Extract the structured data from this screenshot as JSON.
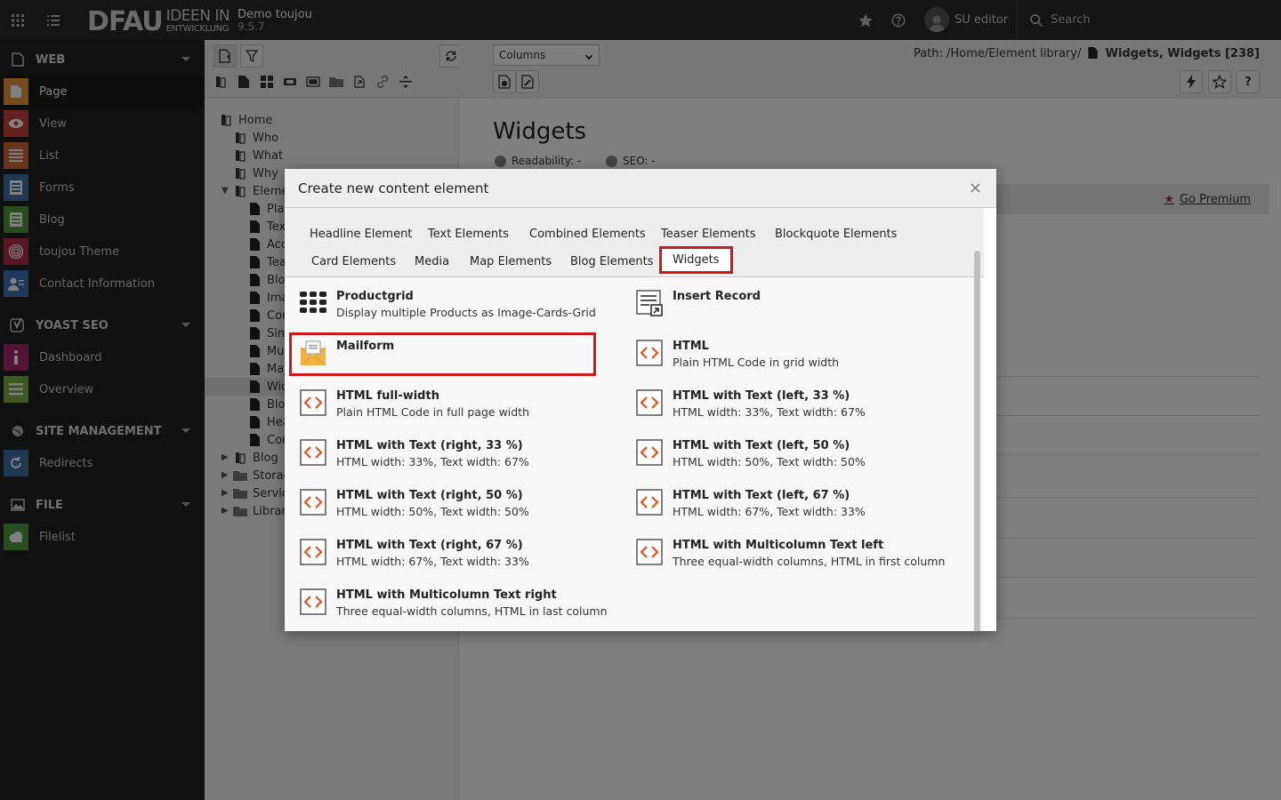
{
  "topbar": {
    "logo_main": "DFAU",
    "logo_line1": "IDEEN IN",
    "logo_line2": "ENTWICKLUNG",
    "site_name": "Demo toujou",
    "site_version": "9.5.7",
    "user_name": "SU editor",
    "search_label": "Search"
  },
  "modules": {
    "web": "WEB",
    "page": "Page",
    "view": "View",
    "list": "List",
    "forms": "Forms",
    "blog": "Blog",
    "theme": "toujou Theme",
    "contact": "Contact Information",
    "yoast": "YOAST SEO",
    "dashboard": "Dashboard",
    "overview": "Overview",
    "site_mgmt": "SITE MANAGEMENT",
    "redirects": "Redirects",
    "file": "FILE",
    "filelist": "Filelist"
  },
  "tree": {
    "home": "Home",
    "who": "Who",
    "what": "What",
    "why": "Why",
    "elem": "Eleme",
    "c1": "Plai",
    "c2": "Tex",
    "c3": "Acc",
    "c4": "Tea",
    "c5": "Blo",
    "c6": "Ima",
    "c7": "Cor",
    "c8": "Sin",
    "c9": "Mul",
    "c10": "Maj",
    "c11": "Wic",
    "c12": "Blo",
    "c13": "Hea",
    "c14": "Cor",
    "blog": "Blog",
    "storage": "Storag",
    "service": "Servic",
    "library": "Librar"
  },
  "docheader": {
    "view_select": "Columns",
    "path_prefix": "Path: /Home/Element library/",
    "path_page": "Widgets, Widgets [238]"
  },
  "page": {
    "title": "Widgets",
    "readability": "Readability: -",
    "seo": "SEO: -",
    "go_premium": "Go Premium"
  },
  "modal": {
    "title": "Create new content element",
    "close": "×",
    "tabs": [
      "Headline Element",
      "Text Elements",
      "Combined Elements",
      "Teaser Elements",
      "Blockquote Elements",
      "Card Elements",
      "Media",
      "Map Elements",
      "Blog Elements",
      "Widgets"
    ],
    "items": [
      {
        "title": "Productgrid",
        "desc": "Display multiple Products as Image-Cards-Grid"
      },
      {
        "title": "Insert Record",
        "desc": ""
      },
      {
        "title": "Mailform",
        "desc": ""
      },
      {
        "title": "HTML",
        "desc": "Plain HTML Code in grid width"
      },
      {
        "title": "HTML full-width",
        "desc": "Plain HTML Code in full page width"
      },
      {
        "title": "HTML with Text (left, 33 %)",
        "desc": "HTML width: 33%, Text width: 67%"
      },
      {
        "title": "HTML with Text (right, 33 %)",
        "desc": "HTML width: 33%, Text width: 67%"
      },
      {
        "title": "HTML with Text (left, 50 %)",
        "desc": "HTML width: 50%, Text width: 50%"
      },
      {
        "title": "HTML with Text (right, 50 %)",
        "desc": "HTML width: 50%, Text width: 50%"
      },
      {
        "title": "HTML with Text (left, 67 %)",
        "desc": "HTML width: 67%, Text width: 33%"
      },
      {
        "title": "HTML with Text (right, 67 %)",
        "desc": "HTML width: 67%, Text width: 33%"
      },
      {
        "title": "HTML with Multicolumn Text left",
        "desc": "Three equal-width columns, HTML in first column"
      },
      {
        "title": "HTML with Multicolumn Text right",
        "desc": "Three equal-width columns, HTML in last column"
      }
    ]
  },
  "colors": {
    "highlight": "#d2181d",
    "html_icon": "#e2531d",
    "topbar": "#292929",
    "sidebar": "#212121"
  }
}
